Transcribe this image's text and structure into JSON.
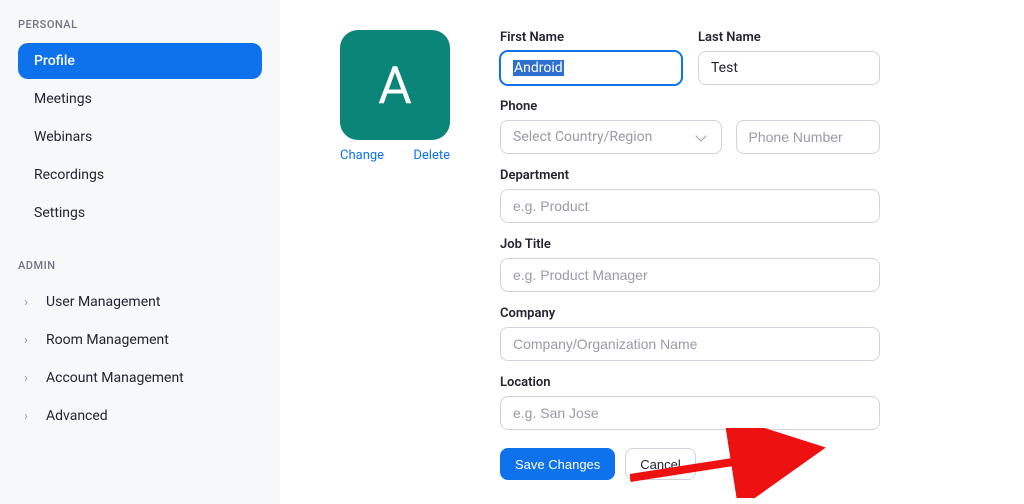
{
  "sidebar": {
    "personal_header": "PERSONAL",
    "admin_header": "ADMIN",
    "personal": [
      {
        "label": "Profile",
        "active": true
      },
      {
        "label": "Meetings",
        "active": false
      },
      {
        "label": "Webinars",
        "active": false
      },
      {
        "label": "Recordings",
        "active": false
      },
      {
        "label": "Settings",
        "active": false
      }
    ],
    "admin": [
      {
        "label": "User Management"
      },
      {
        "label": "Room Management"
      },
      {
        "label": "Account Management"
      },
      {
        "label": "Advanced"
      }
    ]
  },
  "avatar": {
    "initial": "A",
    "change": "Change",
    "delete": "Delete"
  },
  "form": {
    "first_name_label": "First Name",
    "first_name_value": "Android",
    "last_name_label": "Last Name",
    "last_name_value": "Test",
    "phone_label": "Phone",
    "phone_country_placeholder": "Select Country/Region",
    "phone_number_placeholder": "Phone Number",
    "department_label": "Department",
    "department_placeholder": "e.g. Product",
    "job_title_label": "Job Title",
    "job_title_placeholder": "e.g. Product Manager",
    "company_label": "Company",
    "company_placeholder": "Company/Organization Name",
    "location_label": "Location",
    "location_placeholder": "e.g. San Jose",
    "save": "Save Changes",
    "cancel": "Cancel"
  }
}
